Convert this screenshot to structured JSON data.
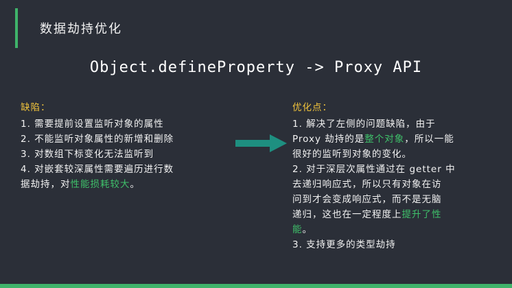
{
  "header": {
    "title": "数据劫持优化"
  },
  "main_title": "Object.defineProperty -> Proxy API",
  "left_panel": {
    "heading": "缺陷：",
    "items": [
      "1. 需要提前设置监听对象的属性",
      "2. 不能监听对象属性的新增和删除",
      "3. 对数组下标变化无法监听到"
    ],
    "item4_part1": "4. 对嵌套较深属性需要遍历进行数",
    "item4_part2": "据劫持，对",
    "item4_highlight": "性能损耗较大",
    "item4_part3": "。"
  },
  "right_panel": {
    "heading": "优化点：",
    "p1_a": "1. 解决了左侧的问题缺陷，由于",
    "p1_b": "Proxy 劫持的是",
    "p1_highlight": "整个对象",
    "p1_c": "，所以一能",
    "p1_d": "很好的监听到对象的变化。",
    "p2_a": "2. 对于深层次属性通过在 getter 中",
    "p2_b": "去递归响应式，所以只有对象在访",
    "p2_c": "问到才会变成响应式，而不是无脑",
    "p2_d": "递归，这也在一定程度上",
    "p2_highlight": "提升了性",
    "p2_e": "能",
    "p2_f": "。",
    "p3": "3. 支持更多的类型劫持"
  },
  "colors": {
    "background": "#2b2f38",
    "accent": "#3fb36a",
    "heading": "#f0c33c",
    "highlight": "#3fc06a",
    "arrow": "#1e8f80"
  }
}
